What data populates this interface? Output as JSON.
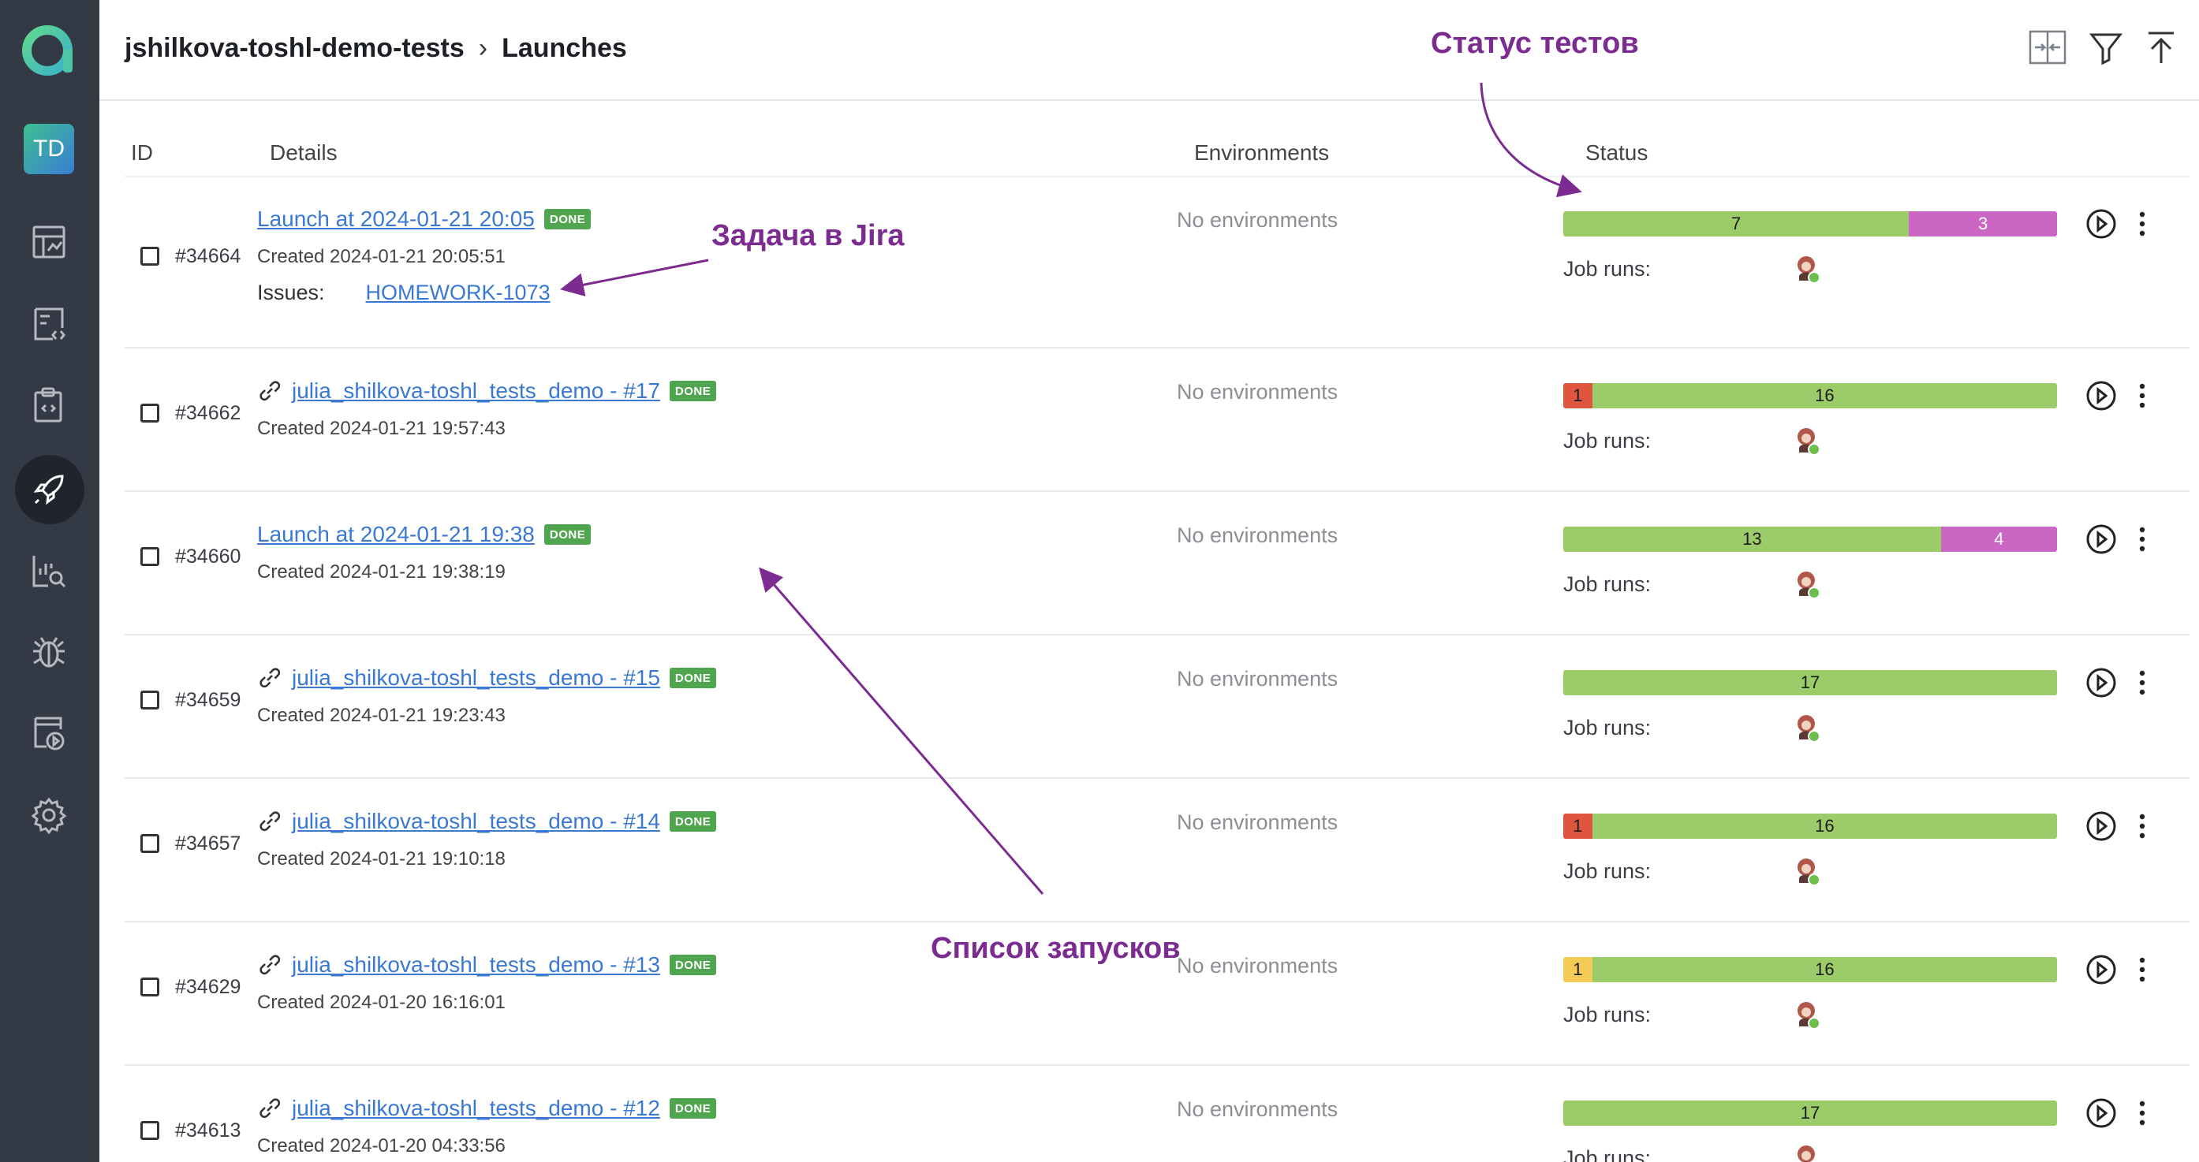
{
  "breadcrumb": {
    "project": "jshilkova-toshl-demo-tests",
    "page": "Launches"
  },
  "sidebar": {
    "user_initials": "TD"
  },
  "columns": {
    "id": "ID",
    "details": "Details",
    "environments": "Environments",
    "status": "Status"
  },
  "labels": {
    "job_runs": "Job runs:",
    "issues": "Issues:",
    "done_badge": "DONE"
  },
  "colors": {
    "failed": "#e0553f",
    "passed": "#9ccb6a",
    "skipped": "#cc66c4",
    "broken": "#f3cb56",
    "link": "#3a78d4",
    "annotation": "#7c2b91",
    "sidebar": "#343a45"
  },
  "launches": [
    {
      "id": "#34664",
      "title": "Launch at 2024-01-21 20:05",
      "has_link_icon": false,
      "created": "Created 2024-01-21 20:05:51",
      "issue": "HOMEWORK-1073",
      "environment": "No environments",
      "status": [
        {
          "type": "passed",
          "value": "7"
        },
        {
          "type": "skipped",
          "value": "3"
        }
      ]
    },
    {
      "id": "#34662",
      "title": "julia_shilkova-toshl_tests_demo - #17",
      "has_link_icon": true,
      "created": "Created 2024-01-21 19:57:43",
      "environment": "No environments",
      "status": [
        {
          "type": "failed",
          "value": "1"
        },
        {
          "type": "passed",
          "value": "16"
        }
      ]
    },
    {
      "id": "#34660",
      "title": "Launch at 2024-01-21 19:38",
      "has_link_icon": false,
      "created": "Created 2024-01-21 19:38:19",
      "environment": "No environments",
      "status": [
        {
          "type": "passed",
          "value": "13"
        },
        {
          "type": "skipped",
          "value": "4"
        }
      ]
    },
    {
      "id": "#34659",
      "title": "julia_shilkova-toshl_tests_demo - #15",
      "has_link_icon": true,
      "created": "Created 2024-01-21 19:23:43",
      "environment": "No environments",
      "status": [
        {
          "type": "passed",
          "value": "17"
        }
      ]
    },
    {
      "id": "#34657",
      "title": "julia_shilkova-toshl_tests_demo - #14",
      "has_link_icon": true,
      "created": "Created 2024-01-21 19:10:18",
      "environment": "No environments",
      "status": [
        {
          "type": "failed",
          "value": "1"
        },
        {
          "type": "passed",
          "value": "16"
        }
      ]
    },
    {
      "id": "#34629",
      "title": "julia_shilkova-toshl_tests_demo - #13",
      "has_link_icon": true,
      "created": "Created 2024-01-20 16:16:01",
      "environment": "No environments",
      "status": [
        {
          "type": "broken",
          "value": "1"
        },
        {
          "type": "passed",
          "value": "16"
        }
      ]
    },
    {
      "id": "#34613",
      "title": "julia_shilkova-toshl_tests_demo - #12",
      "has_link_icon": true,
      "created": "Created 2024-01-20 04:33:56",
      "environment": "No environments",
      "status": [
        {
          "type": "passed",
          "value": "17"
        }
      ]
    }
  ],
  "annotations": {
    "status": "Статус тестов",
    "jira": "Задача в Jira",
    "list": "Список запусков"
  }
}
